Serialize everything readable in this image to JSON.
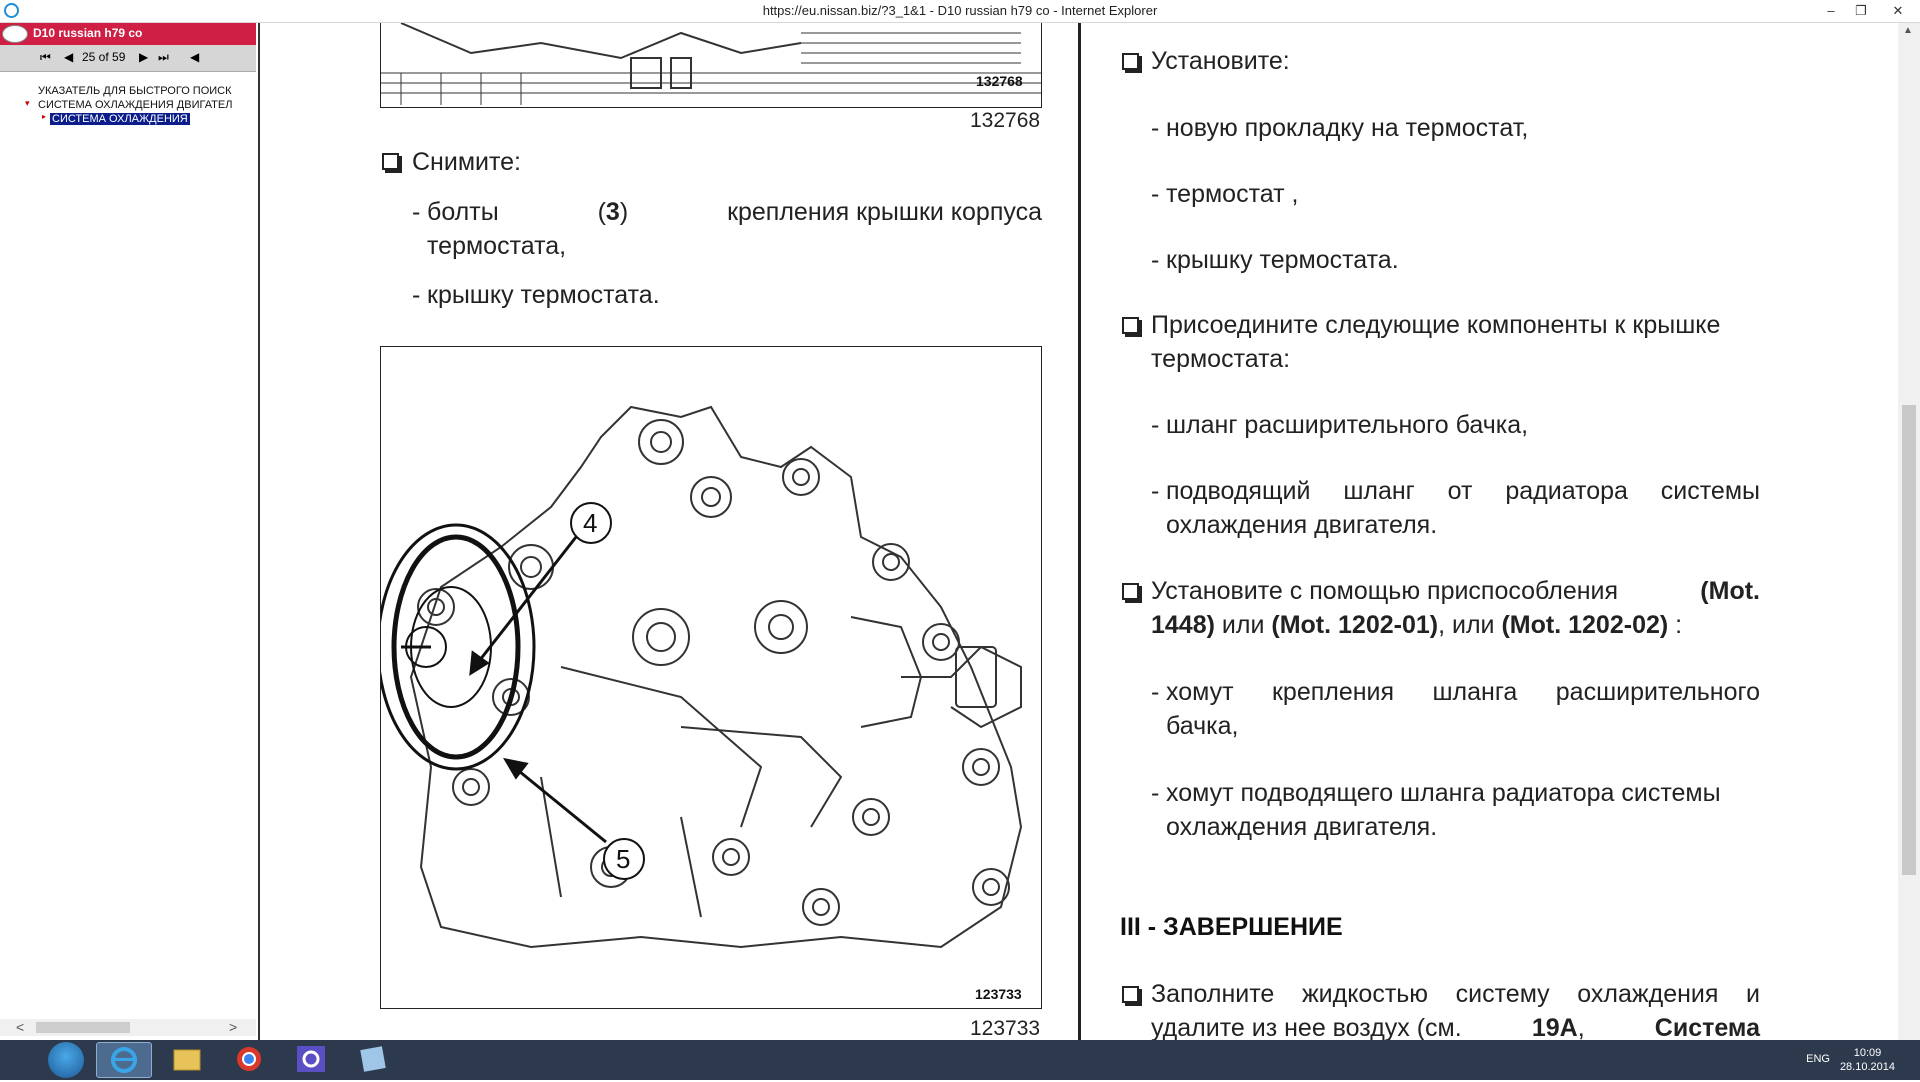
{
  "window": {
    "title": "https://eu.nissan.biz/?3_1&1 - D10 russian h79 co - Internet Explorer",
    "minimize": "–",
    "restore": "❐",
    "close": "✕"
  },
  "sidebar": {
    "doc_title": "D10 russian h79 co",
    "nav": {
      "first": "⏮",
      "prev": "◀",
      "page": "25 of 59",
      "next": "▶",
      "last": "⏭",
      "back": "◀"
    },
    "tree": [
      {
        "label": "УКАЗАТЕЛЬ ДЛЯ БЫСТРОГО ПОИСК"
      },
      {
        "label": "СИСТЕМА ОХЛАЖДЕНИЯ ДВИГАТЕЛ"
      },
      {
        "label": "СИСТЕМА ОХЛАЖДЕНИЯ"
      }
    ],
    "scroll_left": "<",
    "scroll_right": ">"
  },
  "document": {
    "fig1": {
      "label": "132768",
      "caption": "132768"
    },
    "left": {
      "remove_heading": "Снимите:",
      "item1_a": "болты",
      "item1_num": "3",
      "item1_b": "крепления крышки корпуса",
      "item1_c": "термостата,",
      "item2": "крышку термостата.",
      "dash": "-",
      "lparen": "(",
      "rparen": ")"
    },
    "fig2": {
      "label": "123733",
      "caption": "123733",
      "callout4": "4",
      "callout5": "5"
    },
    "right": {
      "install_heading": "Установите:",
      "install_items": [
        "новую прокладку на термостат,",
        "термостат ,",
        "крышку термостата."
      ],
      "connect_heading_1": "Присоедините следующие компоненты к крышке",
      "connect_heading_2": "термостата:",
      "connect_item1": "шланг расширительного бачка,",
      "connect_item2_1": "подводящий шланг от радиатора системы",
      "connect_item2_2": "охлаждения двигателя.",
      "tool_1a": "Установите с помощью приспособления",
      "tool_1b": "(Mot.",
      "tool_2a": "1448)",
      "tool_2b": "или",
      "tool_2c": "(Mot. 1202-01)",
      "tool_2d": ", или",
      "tool_2e": "(Mot. 1202-02)",
      "tool_2f": ":",
      "clamp1_1": "хомут крепления шланга расширительного",
      "clamp1_2": "бачка,",
      "clamp2_1": "хомут подводящего шланга радиатора системы",
      "clamp2_2": "охлаждения двигателя.",
      "section": "III - ЗАВЕРШЕНИЕ",
      "fill_1": "Заполните жидкостью систему охлаждения и",
      "fill_2a": "удалите из нее воздух (см.",
      "fill_2b": "19A",
      "fill_2c": ",",
      "fill_2d": "Система"
    }
  },
  "taskbar": {
    "lang": "ENG",
    "time": "10:09",
    "date": "28.10.2014"
  },
  "colors": {
    "header_red": "#cf1f45",
    "tree_select": "#0a1d8a",
    "taskbar": "#2d3a4d"
  }
}
